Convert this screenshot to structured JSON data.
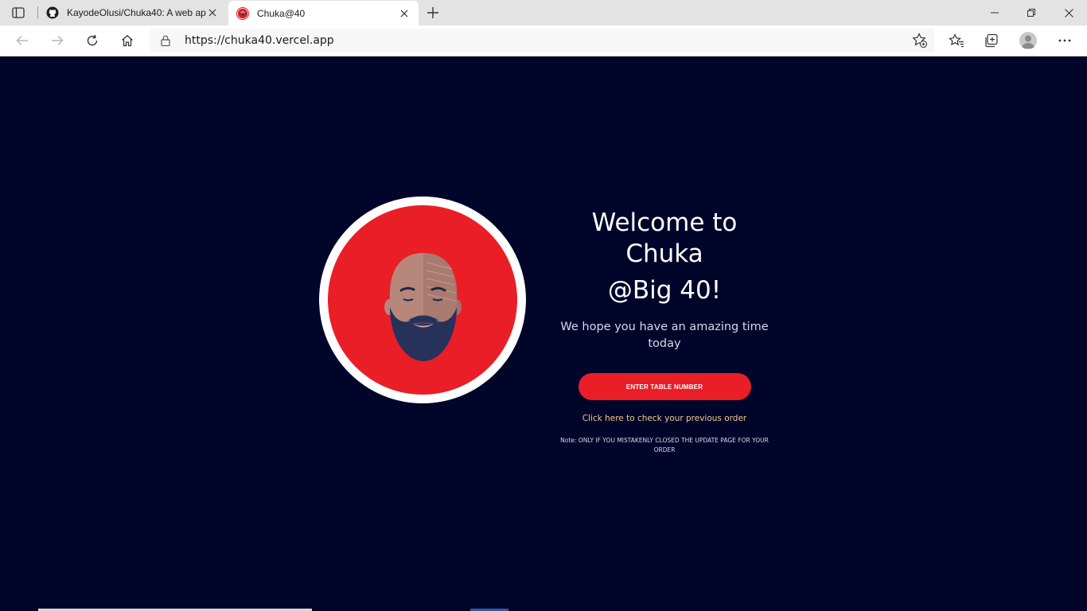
{
  "browser": {
    "tabs": [
      {
        "title": "KayodeOlusi/Chuka40: A web ap",
        "icon": "github-icon",
        "active": false
      },
      {
        "title": "Chuka@40",
        "icon": "site-favicon",
        "active": true
      }
    ],
    "url": "https://chuka40.vercel.app"
  },
  "hero": {
    "title_line1": "Welcome to",
    "title_line2": "Chuka",
    "title_line3": "@Big 40!",
    "subtitle": "We hope you have an amazing time today",
    "cta_label": "ENTER TABLE NUMBER",
    "previous_order_link": "Click here to check your previous order",
    "note": "Note: ONLY IF YOU MISTAKENLY CLOSED THE UPDATE PAGE FOR YOUR ORDER"
  },
  "colors": {
    "page_background": "#02052a",
    "accent_red": "#ea1e27",
    "link_gold": "#f0c98a"
  }
}
